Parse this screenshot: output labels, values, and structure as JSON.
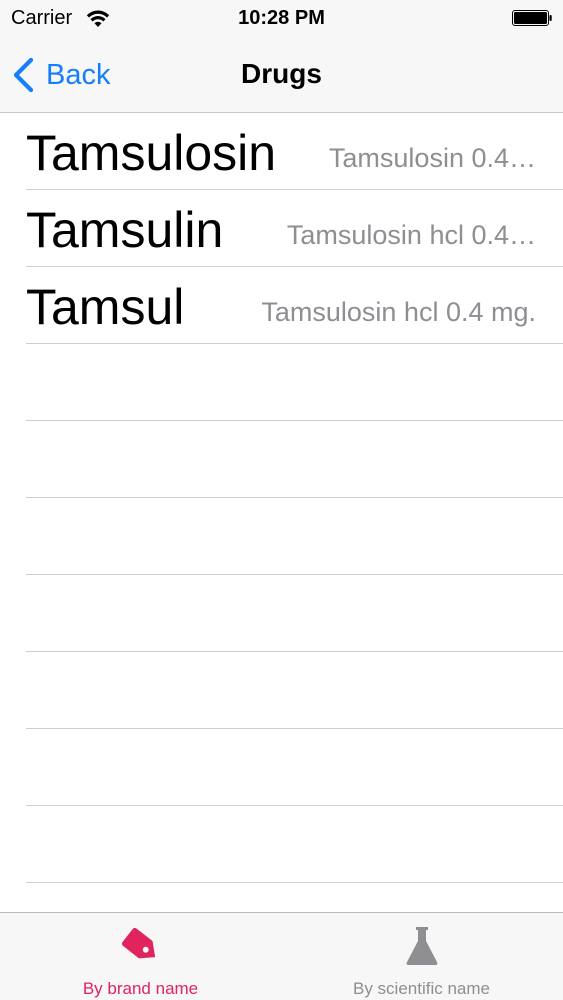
{
  "status_bar": {
    "carrier": "Carrier",
    "time": "10:28 PM"
  },
  "nav": {
    "back_label": "Back",
    "title": "Drugs"
  },
  "drugs": [
    {
      "brand": "Tamsulosin",
      "scientific": "Tamsulosin  0.4…"
    },
    {
      "brand": "Tamsulin",
      "scientific": "Tamsulosin hcl 0.4…"
    },
    {
      "brand": "Tamsul",
      "scientific": "Tamsulosin hcl 0.4 mg."
    }
  ],
  "tabs": [
    {
      "label": "By brand name",
      "icon": "tag-icon",
      "selected": true
    },
    {
      "label": "By scientific name",
      "icon": "flask-icon",
      "selected": false
    }
  ],
  "colors": {
    "accent_blue": "#157efb",
    "tab_selected": "#e0245e",
    "tab_unselected": "#8e8e93",
    "secondary_text": "#8e8e93"
  }
}
